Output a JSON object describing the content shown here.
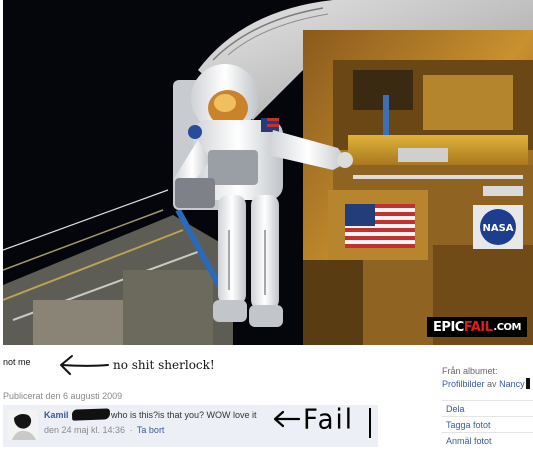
{
  "photo": {
    "watermark": {
      "part1": "EPIC",
      "part2": "FAIL",
      "part3": ".COM"
    },
    "nasa_logo_text": "NASA"
  },
  "caption": "not me",
  "scribble_note": "no shit sherlock!",
  "published": "Publicerat den 6 augusti 2009",
  "comment": {
    "author": "Kamil",
    "text": "who is this?is that you? WOW love it",
    "time": "den 24 maj kl. 14:36",
    "separator": "·",
    "delete_label": "Ta bort",
    "fail_label": "Fail"
  },
  "album": {
    "from_label": "Från albumet:",
    "album_name": "Profilbilder",
    "by_label": "av",
    "owner": "Nancy"
  },
  "actions": [
    "Dela",
    "Tagga fotot",
    "Anmäl fotot"
  ],
  "colors": {
    "link": "#3b5998",
    "comment_bg": "#eceff5",
    "meta": "#8a8a8a"
  }
}
